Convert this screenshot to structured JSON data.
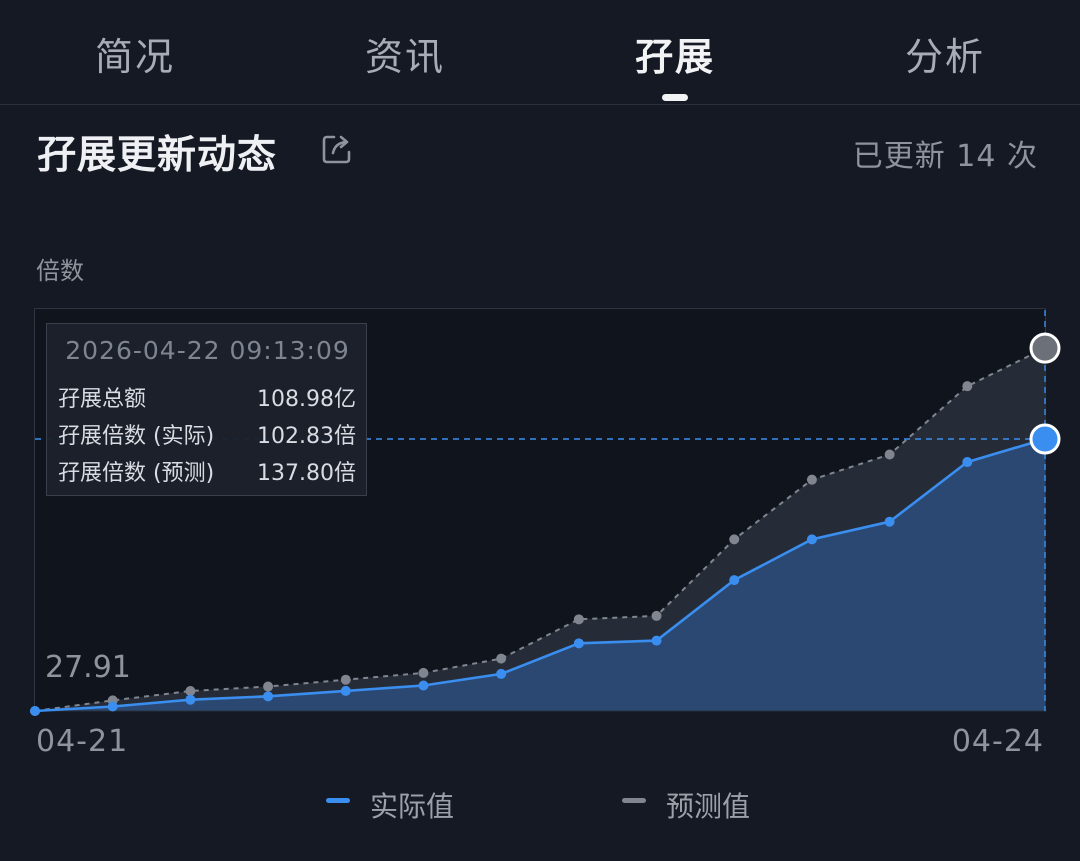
{
  "tabs": [
    {
      "label": "简况"
    },
    {
      "label": "资讯"
    },
    {
      "label": "孖展"
    },
    {
      "label": "分析"
    }
  ],
  "section": {
    "title": "孖展更新动态",
    "update_count": "已更新 14 次"
  },
  "colors": {
    "actual": "#3a8eef",
    "forecast": "#80858f",
    "background": "#141923"
  },
  "tooltip": {
    "datetime": "2026-04-22 09:13:09",
    "rows": [
      {
        "label": "孖展总额",
        "value": "108.98亿"
      },
      {
        "label": "孖展倍数 (实际)",
        "value": "102.83倍"
      },
      {
        "label": "孖展倍数 (预测)",
        "value": "137.80倍"
      }
    ]
  },
  "chart_data": {
    "type": "line",
    "ylabel": "倍数",
    "min_label": "27.91",
    "x_tick_labels": [
      "04-21",
      "04-24"
    ],
    "ylim": [
      27.91,
      137.8
    ],
    "series": [
      {
        "name": "实际值",
        "color": "#3a8eef",
        "values": [
          27.91,
          29.73,
          32.47,
          33.84,
          36.02,
          38.22,
          42.89,
          55.25,
          56.35,
          80.78,
          97.25,
          104.39,
          128.49,
          137.8
        ]
      },
      {
        "name": "预测值",
        "color": "#80858f",
        "values": [
          27.91,
          32.2,
          35.99,
          37.79,
          40.55,
          43.29,
          49.06,
          64.95,
          66.33,
          97.25,
          121.37,
          131.53,
          159.15,
          174.52
        ]
      }
    ],
    "crosshair_value": 137.8,
    "legend": [
      "实际值",
      "预测值"
    ]
  }
}
